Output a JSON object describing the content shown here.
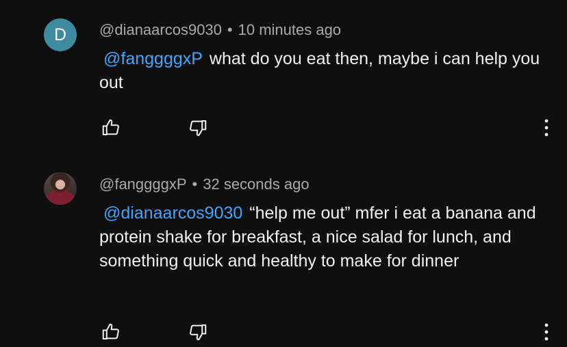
{
  "comments": [
    {
      "avatar_letter": "D",
      "avatar_color": "#3e8ba0",
      "author": "@dianaarcos9030",
      "separator": "•",
      "time": "10 minutes ago",
      "mention": "@fanggggxP",
      "text": "what do you eat then, maybe i can help you out",
      "icons": {
        "like": "thumbs-up-icon",
        "dislike": "thumbs-down-icon",
        "more": "more-vertical-icon"
      }
    },
    {
      "avatar_description": "profile photo",
      "author": "@fanggggxP",
      "separator": "•",
      "time": "32 seconds ago",
      "mention": "@dianaarcos9030",
      "text": "“help me out” mfer i eat a banana and protein shake for breakfast, a nice salad for lunch, and something quick and healthy to make for dinner",
      "icons": {
        "like": "thumbs-up-icon",
        "dislike": "thumbs-down-icon",
        "more": "more-vertical-icon"
      }
    }
  ],
  "colors": {
    "background": "#0f0f0f",
    "text": "#f1f1f1",
    "meta": "#aaaaaa",
    "mention": "#3ea6ff"
  }
}
